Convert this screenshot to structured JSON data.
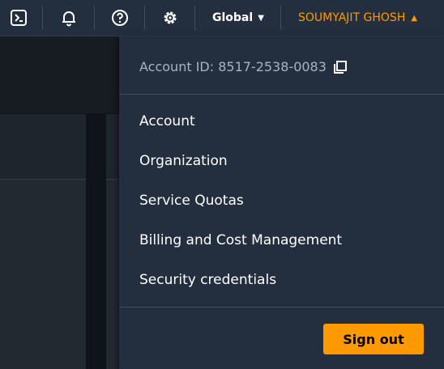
{
  "topbar": {
    "icons": [
      "cloudshell-icon",
      "bell-icon",
      "help-icon",
      "gear-icon"
    ],
    "region_label": "Global",
    "user_label": "SOUMYAJIT GHOSH",
    "accent_color": "#ff9900"
  },
  "dropdown": {
    "account_id_label": "Account ID: 8517-2538-0083",
    "menu_items": [
      {
        "label": "Account"
      },
      {
        "label": "Organization"
      },
      {
        "label": "Service Quotas"
      },
      {
        "label": "Billing and Cost Management"
      },
      {
        "label": "Security credentials"
      }
    ],
    "sign_out_label": "Sign out"
  }
}
